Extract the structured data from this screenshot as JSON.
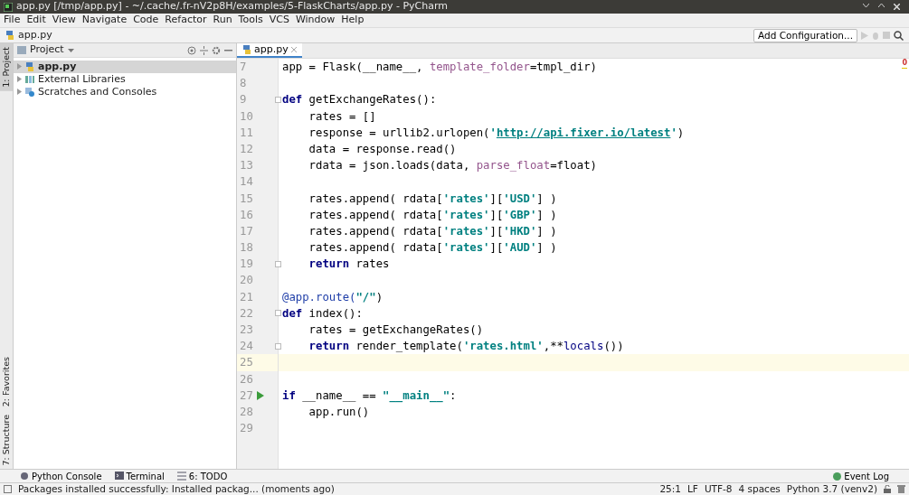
{
  "window": {
    "title": "app.py [/tmp/app.py] - ~/.cache/.fr-nV2p8H/examples/5-FlaskCharts/app.py - PyCharm"
  },
  "menu": [
    "File",
    "Edit",
    "View",
    "Navigate",
    "Code",
    "Refactor",
    "Run",
    "Tools",
    "VCS",
    "Window",
    "Help"
  ],
  "breadcrumb": "app.py",
  "toolbar": {
    "run_config": "Add Configuration..."
  },
  "left_stripe": [
    {
      "label": "1: Project",
      "selected": true
    },
    {
      "label": "2: Favorites",
      "selected": false
    },
    {
      "label": "7: Structure",
      "selected": false
    }
  ],
  "project_panel": {
    "title": "Project",
    "items": [
      {
        "label": "app.py",
        "kind": "file",
        "selected": true
      },
      {
        "label": "External Libraries",
        "kind": "library",
        "selected": false
      },
      {
        "label": "Scratches and Consoles",
        "kind": "scratch",
        "selected": false
      }
    ]
  },
  "editor": {
    "tabs": [
      {
        "label": "app.py",
        "selected": true
      }
    ],
    "lines": [
      {
        "n": "7",
        "tokens": [
          {
            "t": "app = Flask(__name__, ",
            "kind": "plain"
          },
          {
            "t": "template_folder",
            "kind": "param"
          },
          {
            "t": "=tmpl_dir)",
            "kind": "plain"
          }
        ]
      },
      {
        "n": "8"
      },
      {
        "n": "9",
        "fold": true,
        "tokens": [
          {
            "t": "def",
            "kind": "kw"
          },
          {
            "t": " getExchangeRates():",
            "kind": "plain"
          }
        ]
      },
      {
        "n": "10",
        "indent": true,
        "tokens": [
          {
            "t": "rates = []",
            "kind": "plain"
          }
        ]
      },
      {
        "n": "11",
        "indent": true,
        "tokens": [
          {
            "t": "response = urllib2.urlopen(",
            "kind": "plain"
          },
          {
            "t": "'",
            "kind": "str"
          },
          {
            "t": "http://api.fixer.io/latest",
            "kind": "link"
          },
          {
            "t": "'",
            "kind": "str"
          },
          {
            "t": ")",
            "kind": "plain"
          }
        ]
      },
      {
        "n": "12",
        "indent": true,
        "tokens": [
          {
            "t": "data = response.read()",
            "kind": "plain"
          }
        ]
      },
      {
        "n": "13",
        "indent": true,
        "tokens": [
          {
            "t": "rdata = json.loads(data, ",
            "kind": "plain"
          },
          {
            "t": "parse_float",
            "kind": "param"
          },
          {
            "t": "=float)",
            "kind": "plain"
          }
        ]
      },
      {
        "n": "14"
      },
      {
        "n": "15",
        "indent": true,
        "tokens": [
          {
            "t": "rates.append( rdata[",
            "kind": "plain"
          },
          {
            "t": "'rates'",
            "kind": "str"
          },
          {
            "t": "][",
            "kind": "plain"
          },
          {
            "t": "'USD'",
            "kind": "str"
          },
          {
            "t": "] )",
            "kind": "plain"
          }
        ]
      },
      {
        "n": "16",
        "indent": true,
        "tokens": [
          {
            "t": "rates.append( rdata[",
            "kind": "plain"
          },
          {
            "t": "'rates'",
            "kind": "str"
          },
          {
            "t": "][",
            "kind": "plain"
          },
          {
            "t": "'GBP'",
            "kind": "str"
          },
          {
            "t": "] )",
            "kind": "plain"
          }
        ]
      },
      {
        "n": "17",
        "indent": true,
        "tokens": [
          {
            "t": "rates.append( rdata[",
            "kind": "plain"
          },
          {
            "t": "'rates'",
            "kind": "str"
          },
          {
            "t": "][",
            "kind": "plain"
          },
          {
            "t": "'HKD'",
            "kind": "str"
          },
          {
            "t": "] )",
            "kind": "plain"
          }
        ]
      },
      {
        "n": "18",
        "indent": true,
        "tokens": [
          {
            "t": "rates.append( rdata[",
            "kind": "plain"
          },
          {
            "t": "'rates'",
            "kind": "str"
          },
          {
            "t": "][",
            "kind": "plain"
          },
          {
            "t": "'AUD'",
            "kind": "str"
          },
          {
            "t": "] )",
            "kind": "plain"
          }
        ]
      },
      {
        "n": "19",
        "fold": true,
        "indent": true,
        "tokens": [
          {
            "t": "return",
            "kind": "kw"
          },
          {
            "t": " rates",
            "kind": "plain"
          }
        ]
      },
      {
        "n": "20"
      },
      {
        "n": "21",
        "tokens": [
          {
            "t": "@app.route(",
            "kind": "deco"
          },
          {
            "t": "\"/\"",
            "kind": "str"
          },
          {
            "t": ")",
            "kind": "plain"
          }
        ]
      },
      {
        "n": "22",
        "fold": true,
        "tokens": [
          {
            "t": "def",
            "kind": "kw"
          },
          {
            "t": " index():",
            "kind": "plain"
          }
        ]
      },
      {
        "n": "23",
        "indent": true,
        "tokens": [
          {
            "t": "rates = getExchangeRates()",
            "kind": "plain"
          }
        ]
      },
      {
        "n": "24",
        "fold": true,
        "indent": true,
        "tokens": [
          {
            "t": "return",
            "kind": "kw"
          },
          {
            "t": " render_template(",
            "kind": "plain"
          },
          {
            "t": "'rates.html'",
            "kind": "str"
          },
          {
            "t": ",**",
            "kind": "plain"
          },
          {
            "t": "locals",
            "kind": "builtin"
          },
          {
            "t": "())",
            "kind": "plain"
          }
        ]
      },
      {
        "n": "25",
        "current": true
      },
      {
        "n": "26"
      },
      {
        "n": "27",
        "run": true,
        "tokens": [
          {
            "t": "if",
            "kind": "kw"
          },
          {
            "t": " __name__ == ",
            "kind": "plain"
          },
          {
            "t": "\"__main__\"",
            "kind": "str"
          },
          {
            "t": ":",
            "kind": "plain"
          }
        ]
      },
      {
        "n": "28",
        "indent": true,
        "tokens": [
          {
            "t": "app.run()",
            "kind": "plain"
          }
        ]
      },
      {
        "n": "29"
      }
    ],
    "error_count": "0"
  },
  "bottom_tools": [
    {
      "label": "Python Console",
      "kind": "console"
    },
    {
      "label": "Terminal",
      "kind": "terminal"
    },
    {
      "label": "6: TODO",
      "kind": "todo"
    }
  ],
  "event_log": "Event Log",
  "status_bar": {
    "message": "Packages installed successfully: Installed packag... (moments ago)",
    "position": "25:1",
    "line_sep": "LF",
    "encoding": "UTF-8",
    "indent": "4 spaces",
    "interpreter": "Python 3.7 (venv2)"
  }
}
